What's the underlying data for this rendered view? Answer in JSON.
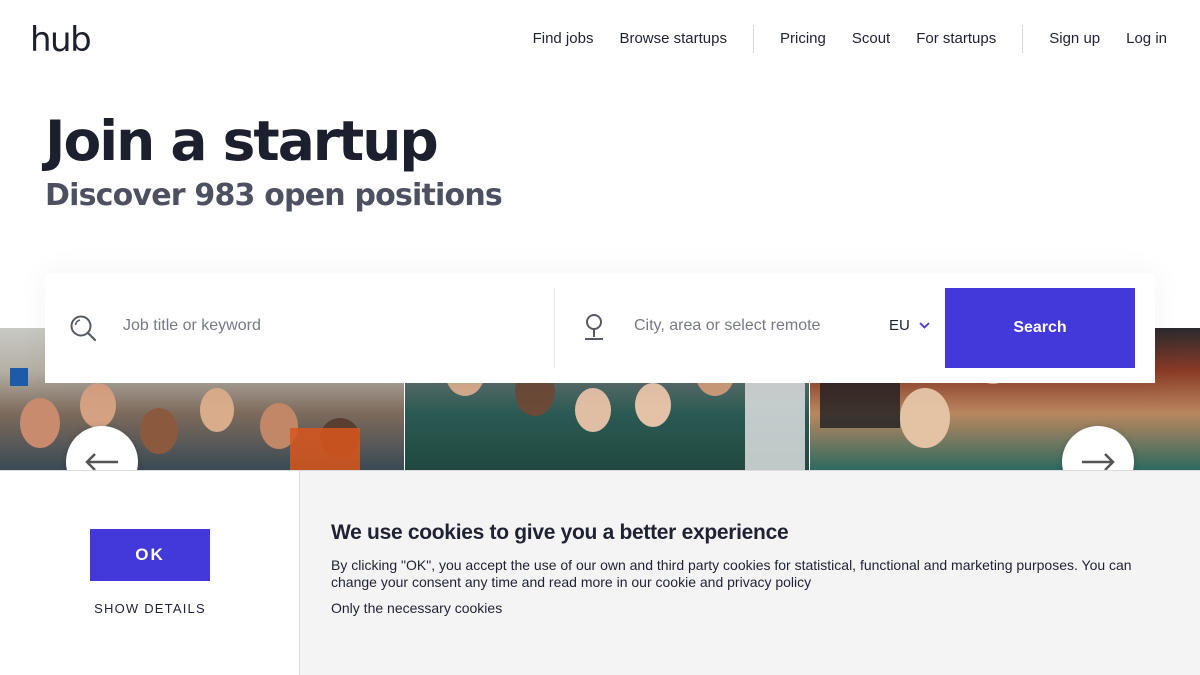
{
  "header": {
    "logo": "hub",
    "nav": {
      "find_jobs": "Find jobs",
      "browse_startups": "Browse startups",
      "pricing": "Pricing",
      "scout": "Scout",
      "for_startups": "For startups",
      "sign_up": "Sign up",
      "log_in": "Log in"
    }
  },
  "hero": {
    "title": "Join a startup",
    "subtitle": "Discover 983 open positions"
  },
  "search": {
    "keyword_placeholder": "Job title or keyword",
    "keyword_value": "",
    "location_placeholder": "City, area or select remote",
    "location_value": "",
    "region": "EU",
    "button_label": "Search",
    "icons": [
      "search-icon",
      "location-pin-icon",
      "chevron-down-icon"
    ]
  },
  "carousel": {
    "photos": [
      "team-photo-flags",
      "team-photo-booth",
      "team-photo-gym"
    ],
    "icons": [
      "arrow-left-icon",
      "arrow-right-icon"
    ]
  },
  "cookie_banner": {
    "ok_label": "OK",
    "details_label": "SHOW DETAILS",
    "title": "We use cookies to give you a better experience",
    "text": "By clicking \"OK\", you accept the use of our own and third party cookies for statistical, functional and marketing purposes. You can change your consent any time and read more in our cookie and privacy policy",
    "necessary_label": "Only the necessary cookies"
  },
  "colors": {
    "accent": "#4338d9",
    "text": "#1f2233",
    "subtitle": "#4c5061",
    "banner_bg": "#f4f4f5"
  }
}
